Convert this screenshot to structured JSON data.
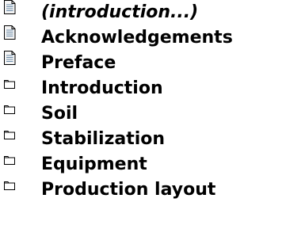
{
  "toc": {
    "items": [
      {
        "label": "(introduction...)",
        "icon": "document-icon",
        "italic": true
      },
      {
        "label": "Acknowledgements",
        "icon": "document-icon",
        "italic": false
      },
      {
        "label": "Preface",
        "icon": "document-icon",
        "italic": false
      },
      {
        "label": "Introduction",
        "icon": "folder-icon",
        "italic": false
      },
      {
        "label": "Soil",
        "icon": "folder-icon",
        "italic": false
      },
      {
        "label": "Stabilization",
        "icon": "folder-icon",
        "italic": false
      },
      {
        "label": "Equipment",
        "icon": "folder-icon",
        "italic": false
      },
      {
        "label": "Production layout",
        "icon": "folder-icon",
        "italic": false
      }
    ]
  },
  "colors": {
    "text": "#000000",
    "icon_stroke": "#000000",
    "doc_fill": "#f4f4f4",
    "doc_lines": "#6a8aa8",
    "folder_fill": "#ffffff"
  }
}
